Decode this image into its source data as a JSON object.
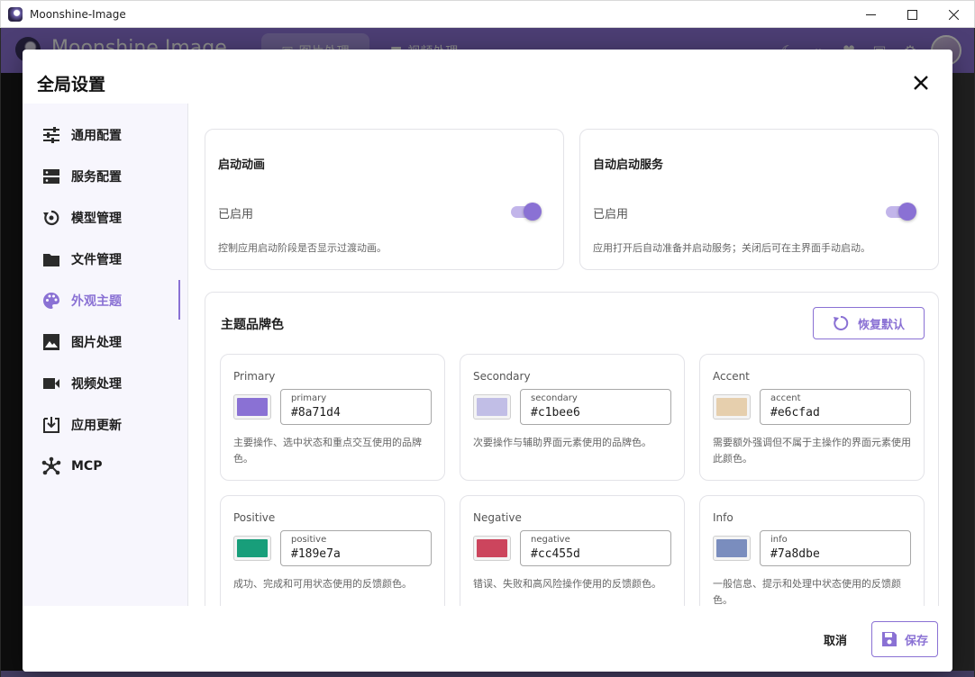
{
  "window": {
    "title": "Moonshine-Image",
    "controls": [
      "minimize-icon",
      "maximize-icon",
      "close-icon"
    ]
  },
  "app_header": {
    "brand": "Moonshine Image",
    "tabs": [
      {
        "label": "图片处理",
        "active": true
      },
      {
        "label": "视频处理",
        "active": false
      }
    ]
  },
  "dialog": {
    "title": "全局设置",
    "sidebar": {
      "items": [
        {
          "label": "通用配置",
          "icon": "sliders-icon",
          "active": false
        },
        {
          "label": "服务配置",
          "icon": "server-icon",
          "active": false
        },
        {
          "label": "模型管理",
          "icon": "model-refresh-icon",
          "active": false
        },
        {
          "label": "文件管理",
          "icon": "folder-icon",
          "active": false
        },
        {
          "label": "外观主题",
          "icon": "palette-icon",
          "active": true
        },
        {
          "label": "图片处理",
          "icon": "image-icon",
          "active": false
        },
        {
          "label": "视频处理",
          "icon": "video-icon",
          "active": false
        },
        {
          "label": "应用更新",
          "icon": "download-icon",
          "active": false
        },
        {
          "label": "MCP",
          "icon": "hub-icon",
          "active": false
        }
      ]
    },
    "settings": {
      "startup_animation": {
        "title": "启动动画",
        "status": "已启用",
        "enabled": true,
        "description": "控制应用启动阶段是否显示过渡动画。"
      },
      "auto_start_service": {
        "title": "自动启动服务",
        "status": "已启用",
        "enabled": true,
        "description": "应用打开后自动准备并启动服务；关闭后可在主界面手动启动。"
      }
    },
    "brand_colors": {
      "title": "主题品牌色",
      "reset_label": "恢复默认",
      "colors": [
        {
          "label": "Primary",
          "field_label": "primary",
          "value": "#8a71d4",
          "description": "主要操作、选中状态和重点交互使用的品牌色。"
        },
        {
          "label": "Secondary",
          "field_label": "secondary",
          "value": "#c1bee6",
          "description": "次要操作与辅助界面元素使用的品牌色。"
        },
        {
          "label": "Accent",
          "field_label": "accent",
          "value": "#e6cfad",
          "description": "需要额外强调但不属于主操作的界面元素使用此颜色。"
        },
        {
          "label": "Positive",
          "field_label": "positive",
          "value": "#189e7a",
          "description": "成功、完成和可用状态使用的反馈颜色。"
        },
        {
          "label": "Negative",
          "field_label": "negative",
          "value": "#cc455d",
          "description": "错误、失败和高风险操作使用的反馈颜色。"
        },
        {
          "label": "Info",
          "field_label": "info",
          "value": "#7a8dbe",
          "description": "一般信息、提示和处理中状态使用的反馈颜色。"
        }
      ]
    },
    "footer": {
      "cancel_label": "取消",
      "save_label": "保存"
    }
  }
}
